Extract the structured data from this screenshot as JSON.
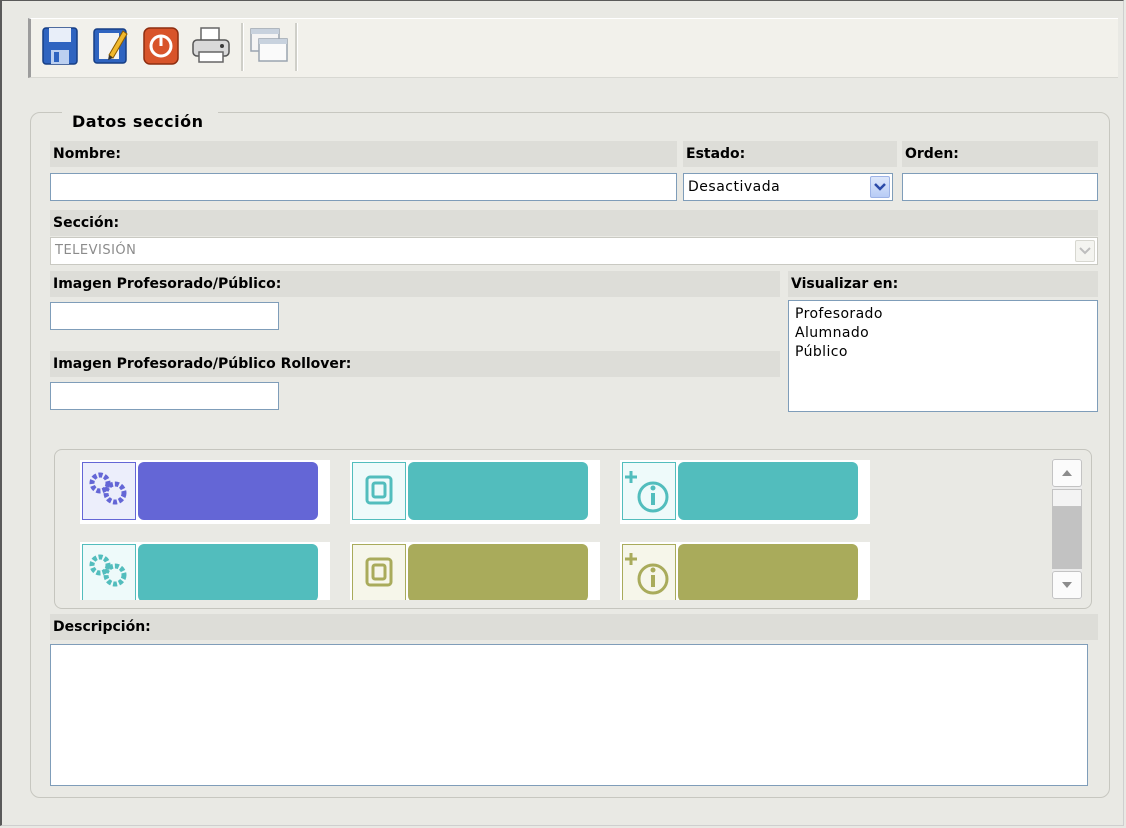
{
  "toolbar": {
    "buttons": [
      "save-icon",
      "edit-icon",
      "power-icon",
      "print-icon",
      "windows-icon"
    ]
  },
  "form": {
    "legend": "Datos sección",
    "nombre": {
      "label": "Nombre:",
      "value": ""
    },
    "estado": {
      "label": "Estado:",
      "value": "Desactivada"
    },
    "orden": {
      "label": "Orden:",
      "value": ""
    },
    "seccion": {
      "label": "Sección:",
      "value": "TELEVISIÓN"
    },
    "imagen": {
      "label": "Imagen Profesorado/Público:",
      "value": ""
    },
    "imagen_rollover": {
      "label": "Imagen Profesorado/Público Rollover:",
      "value": ""
    },
    "visualizar": {
      "label": "Visualizar en:",
      "options": [
        "Profesorado",
        "Alumnado",
        "Público"
      ]
    },
    "descripcion": {
      "label": "Descripción:",
      "value": ""
    }
  },
  "icon_tiles": [
    {
      "icon": "gears-icon",
      "color": "#6466d6",
      "row": 1
    },
    {
      "icon": "spiral-icon",
      "color": "#52bdbd",
      "row": 1
    },
    {
      "icon": "info-plus-icon",
      "color": "#52bdbd",
      "row": 1
    },
    {
      "icon": "gears-icon",
      "color": "#52bdbd",
      "row": 2
    },
    {
      "icon": "spiral-icon",
      "color": "#a9ab5b",
      "row": 2
    },
    {
      "icon": "info-plus-icon",
      "color": "#a9ab5b",
      "row": 2
    }
  ],
  "colors": {
    "background": "#e9e9e4",
    "label_bg": "#ddddd8",
    "input_border": "#7f9db9"
  }
}
